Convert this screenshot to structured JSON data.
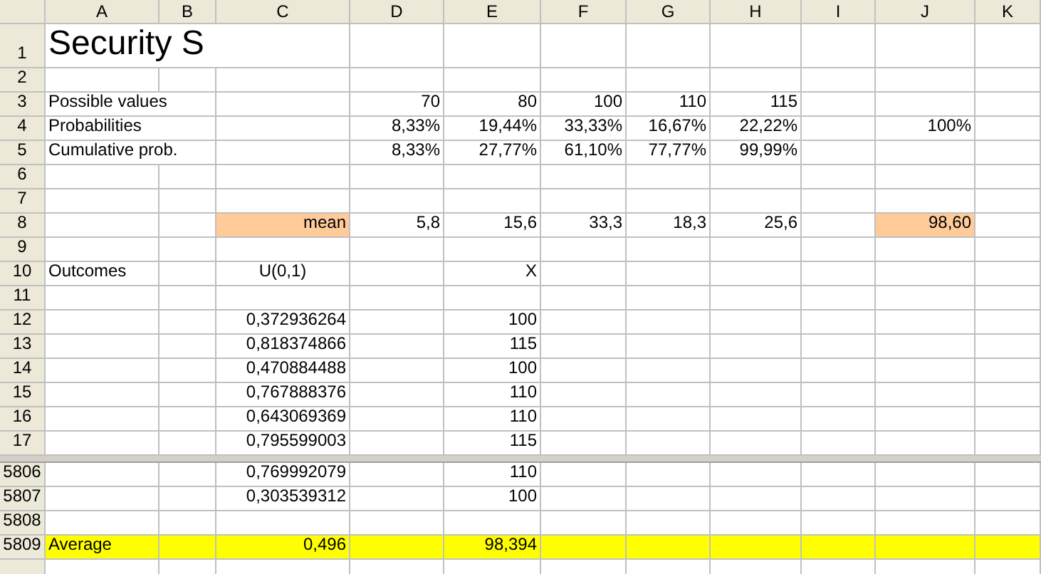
{
  "columns": [
    "A",
    "B",
    "C",
    "D",
    "E",
    "F",
    "G",
    "H",
    "I",
    "J",
    "K"
  ],
  "pane_top": [
    {
      "number": "1",
      "A": {
        "text": "Security S",
        "kind": "title"
      }
    },
    {
      "number": "2"
    },
    {
      "number": "3",
      "A": {
        "text": "Possible values",
        "kind": "left"
      },
      "D": {
        "text": "70",
        "kind": "right"
      },
      "E": {
        "text": "80",
        "kind": "right"
      },
      "F": {
        "text": "100",
        "kind": "right"
      },
      "G": {
        "text": "110",
        "kind": "right"
      },
      "H": {
        "text": "115",
        "kind": "right"
      }
    },
    {
      "number": "4",
      "A": {
        "text": "Probabilities",
        "kind": "left"
      },
      "D": {
        "text": "8,33%",
        "kind": "right"
      },
      "E": {
        "text": "19,44%",
        "kind": "right"
      },
      "F": {
        "text": "33,33%",
        "kind": "right"
      },
      "G": {
        "text": "16,67%",
        "kind": "right"
      },
      "H": {
        "text": "22,22%",
        "kind": "right"
      },
      "J": {
        "text": "100%",
        "kind": "right"
      }
    },
    {
      "number": "5",
      "A": {
        "text": "Cumulative prob.",
        "kind": "left"
      },
      "D": {
        "text": "8,33%",
        "kind": "right"
      },
      "E": {
        "text": "27,77%",
        "kind": "right"
      },
      "F": {
        "text": "61,10%",
        "kind": "right"
      },
      "G": {
        "text": "77,77%",
        "kind": "right"
      },
      "H": {
        "text": "99,99%",
        "kind": "right"
      }
    },
    {
      "number": "6"
    },
    {
      "number": "7"
    },
    {
      "number": "8",
      "C": {
        "text": "mean",
        "kind": "right",
        "color": "#ffcc99"
      },
      "D": {
        "text": "5,8",
        "kind": "right"
      },
      "E": {
        "text": "15,6",
        "kind": "right"
      },
      "F": {
        "text": "33,3",
        "kind": "right"
      },
      "G": {
        "text": "18,3",
        "kind": "right"
      },
      "H": {
        "text": "25,6",
        "kind": "right"
      },
      "J": {
        "text": "98,60",
        "kind": "right",
        "color": "#ffcc99"
      }
    },
    {
      "number": "9"
    },
    {
      "number": "10",
      "A": {
        "text": "Outcomes",
        "kind": "left"
      },
      "C": {
        "text": "U(0,1)",
        "kind": "center"
      },
      "E": {
        "text": "X",
        "kind": "right"
      }
    },
    {
      "number": "11"
    },
    {
      "number": "12",
      "C": {
        "text": "0,372936264",
        "kind": "right"
      },
      "E": {
        "text": "100",
        "kind": "right"
      }
    },
    {
      "number": "13",
      "C": {
        "text": "0,818374866",
        "kind": "right"
      },
      "E": {
        "text": "115",
        "kind": "right"
      }
    },
    {
      "number": "14",
      "C": {
        "text": "0,470884488",
        "kind": "right"
      },
      "E": {
        "text": "100",
        "kind": "right"
      }
    },
    {
      "number": "15",
      "C": {
        "text": "0,767888376",
        "kind": "right"
      },
      "E": {
        "text": "110",
        "kind": "right"
      }
    },
    {
      "number": "16",
      "C": {
        "text": "0,643069369",
        "kind": "right"
      },
      "E": {
        "text": "110",
        "kind": "right"
      }
    },
    {
      "number": "17",
      "C": {
        "text": "0,795599003",
        "kind": "right"
      },
      "E": {
        "text": "115",
        "kind": "right"
      }
    }
  ],
  "pane_bottom": [
    {
      "number": "5806",
      "C": {
        "text": "0,769992079",
        "kind": "right"
      },
      "E": {
        "text": "110",
        "kind": "right"
      }
    },
    {
      "number": "5807",
      "C": {
        "text": "0,303539312",
        "kind": "right"
      },
      "E": {
        "text": "100",
        "kind": "right"
      }
    },
    {
      "number": "5808"
    },
    {
      "number": "5809",
      "color": "#ffff00",
      "A": {
        "text": "Average",
        "kind": "left"
      },
      "C": {
        "text": "0,496",
        "kind": "right"
      },
      "E": {
        "text": "98,394",
        "kind": "right"
      }
    }
  ]
}
